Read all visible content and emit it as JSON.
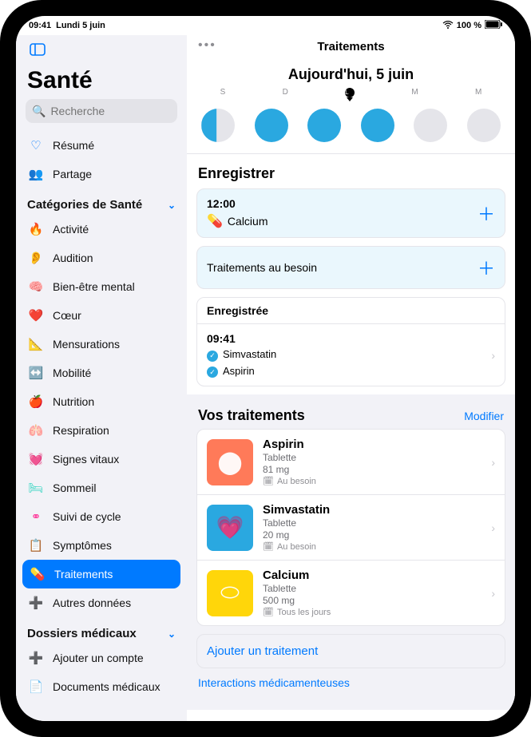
{
  "status": {
    "time": "09:41",
    "date": "Lundi 5 juin",
    "battery": "100 %"
  },
  "sidebar": {
    "title": "Santé",
    "search_placeholder": "Recherche",
    "summary": "Résumé",
    "sharing": "Partage",
    "categories_header": "Catégories de Santé",
    "categories": [
      {
        "label": "Activité",
        "icon": "🔥",
        "color": "#ff3b30"
      },
      {
        "label": "Audition",
        "icon": "👂",
        "color": "#0a84ff"
      },
      {
        "label": "Bien-être mental",
        "icon": "🧠",
        "color": "#30d158"
      },
      {
        "label": "Cœur",
        "icon": "❤️",
        "color": "#ff2d55"
      },
      {
        "label": "Mensurations",
        "icon": "📐",
        "color": "#a16eff"
      },
      {
        "label": "Mobilité",
        "icon": "↔️",
        "color": "#ff9500"
      },
      {
        "label": "Nutrition",
        "icon": "🍎",
        "color": "#34c759"
      },
      {
        "label": "Respiration",
        "icon": "🫁",
        "color": "#5ac8fa"
      },
      {
        "label": "Signes vitaux",
        "icon": "💓",
        "color": "#ff3b30"
      },
      {
        "label": "Sommeil",
        "icon": "🛏",
        "color": "#2dd4bf"
      },
      {
        "label": "Suivi de cycle",
        "icon": "⚭",
        "color": "#ff2d95"
      },
      {
        "label": "Symptômes",
        "icon": "📋",
        "color": "#8e8e93"
      },
      {
        "label": "Traitements",
        "icon": "💊",
        "color": "#5ac8fa",
        "selected": true
      },
      {
        "label": "Autres données",
        "icon": "➕",
        "color": "#5ac8fa"
      }
    ],
    "records_header": "Dossiers médicaux",
    "records": [
      {
        "label": "Ajouter un compte",
        "icon": "➕"
      },
      {
        "label": "Documents médicaux",
        "icon": "📄"
      }
    ]
  },
  "content": {
    "title": "Traitements",
    "date_heading": "Aujourd'hui, 5 juin",
    "weekdays": [
      "S",
      "D",
      "L",
      "M",
      "M"
    ],
    "today_index": 2,
    "day_status": [
      "partial",
      "done",
      "done",
      "done",
      "future",
      "future"
    ],
    "log_header": "Enregistrer",
    "schedule": {
      "time": "12:00",
      "med": "Calcium"
    },
    "as_needed": "Traitements au besoin",
    "logged_header": "Enregistrée",
    "logged": {
      "time": "09:41",
      "items": [
        "Simvastatin",
        "Aspirin"
      ]
    },
    "your_meds_header": "Vos traitements",
    "edit_label": "Modifier",
    "meds": [
      {
        "name": "Aspirin",
        "form": "Tablette",
        "dose": "81 mg",
        "freq": "Au besoin",
        "tile": "o",
        "emoji": "⬤"
      },
      {
        "name": "Simvastatin",
        "form": "Tablette",
        "dose": "20 mg",
        "freq": "Au besoin",
        "tile": "b",
        "emoji": "💗"
      },
      {
        "name": "Calcium",
        "form": "Tablette",
        "dose": "500 mg",
        "freq": "Tous les jours",
        "tile": "y",
        "emoji": "⬭"
      }
    ],
    "add_med": "Ajouter un traitement",
    "interactions_link": "Interactions médicamenteuses"
  }
}
